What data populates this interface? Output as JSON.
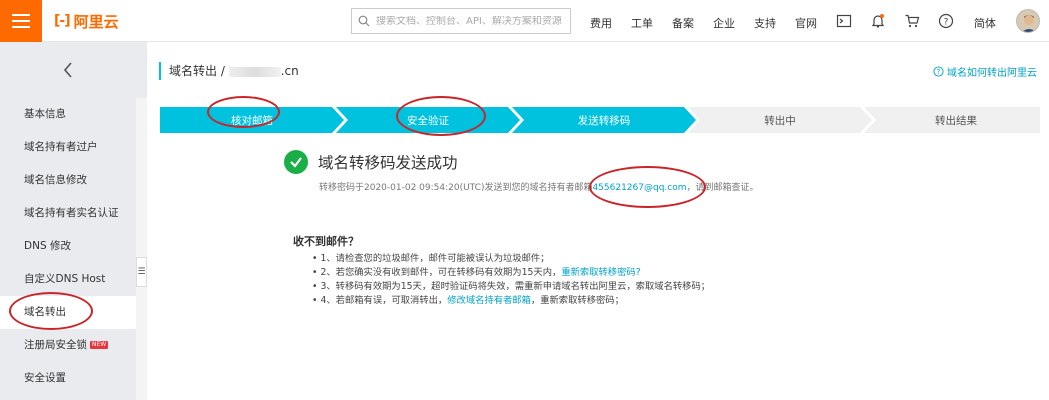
{
  "header": {
    "logo_text": "阿里云",
    "logo_mark": "[-]",
    "search_placeholder": "搜索文档、控制台、API、解决方案和资源",
    "nav": [
      "费用",
      "工单",
      "备案",
      "企业",
      "支持",
      "官网"
    ],
    "lang": "简体",
    "icons": [
      "terminal-icon",
      "bell-icon",
      "cart-icon",
      "help-icon"
    ]
  },
  "sidebar": {
    "items": [
      {
        "label": "基本信息"
      },
      {
        "label": "域名持有者过户"
      },
      {
        "label": "域名信息修改"
      },
      {
        "label": "域名持有者实名认证"
      },
      {
        "label": "DNS 修改"
      },
      {
        "label": "自定义DNS Host"
      },
      {
        "label": "域名转出",
        "active": true
      },
      {
        "label": "注册局安全锁",
        "badge": "NEW"
      },
      {
        "label": "安全设置"
      }
    ]
  },
  "breadcrumb": {
    "prefix": "域名转出 / ",
    "suffix": ".cn"
  },
  "help_link": "域名如何转出阿里云",
  "steps": [
    {
      "label": "核对邮箱",
      "state": "done"
    },
    {
      "label": "安全验证",
      "state": "done"
    },
    {
      "label": "发送转移码",
      "state": "current"
    },
    {
      "label": "转出中",
      "state": "pending"
    },
    {
      "label": "转出结果",
      "state": "pending"
    }
  ],
  "success": {
    "title": "域名转移码发送成功",
    "desc_before": "转移密码于2020-01-02 09:54:20(UTC)发送到您的域名持有者邮箱",
    "email": "455621267@qq.com",
    "desc_after": "，请到邮箱查证。"
  },
  "help": {
    "title": "收不到邮件？",
    "items": [
      {
        "text": "• 1、请检查您的垃圾邮件，邮件可能被误认为垃圾邮件；",
        "link": "",
        "after": ""
      },
      {
        "text": "• 2、若您确实没有收到邮件，可在转移码有效期为15天内，",
        "link": "重新索取转移密码?",
        "after": ""
      },
      {
        "text": "• 3、转移码有效期为15天，超时验证码将失效，需重新申请域名转出阿里云，索取域名转移码；",
        "link": "",
        "after": ""
      },
      {
        "text": "• 4、若邮箱有误，可取消转出，",
        "link": "修改域名持有者邮箱",
        "after": "，重新索取转移密码；"
      }
    ]
  },
  "colors": {
    "brand": "#ff6a00",
    "step_active": "#00c1de",
    "step_pending": "#f0f0f0",
    "success": "#1aaf46",
    "link": "#00a2ca",
    "annotation": "#c8262a"
  }
}
